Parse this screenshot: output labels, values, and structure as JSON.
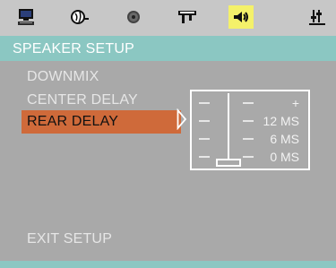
{
  "icons": [
    {
      "name": "monitor-icon",
      "active": false
    },
    {
      "name": "language-globe-icon",
      "active": false
    },
    {
      "name": "disc-icon",
      "active": false
    },
    {
      "name": "video-plug-icon",
      "active": false
    },
    {
      "name": "speaker-icon",
      "active": true
    },
    {
      "name": "preference-sliders-icon",
      "active": false
    }
  ],
  "colors": {
    "icon_bar": "#c7c7c7",
    "active_icon": "#f4f16a",
    "title_bar": "#8bc7c2",
    "panel": "#a9a9a9",
    "selected_item": "#cf6a3a"
  },
  "header": {
    "title": "SPEAKER SETUP"
  },
  "menu": {
    "items": [
      {
        "label": "DOWNMIX",
        "selected": false
      },
      {
        "label": "CENTER DELAY",
        "selected": false
      },
      {
        "label": "REAR DELAY",
        "selected": true
      }
    ],
    "exit_label": "EXIT SETUP"
  },
  "delay_slider": {
    "plus_label": "+",
    "labels": [
      "12 MS",
      "6 MS",
      "0 MS"
    ],
    "current_value_ms": 0
  }
}
